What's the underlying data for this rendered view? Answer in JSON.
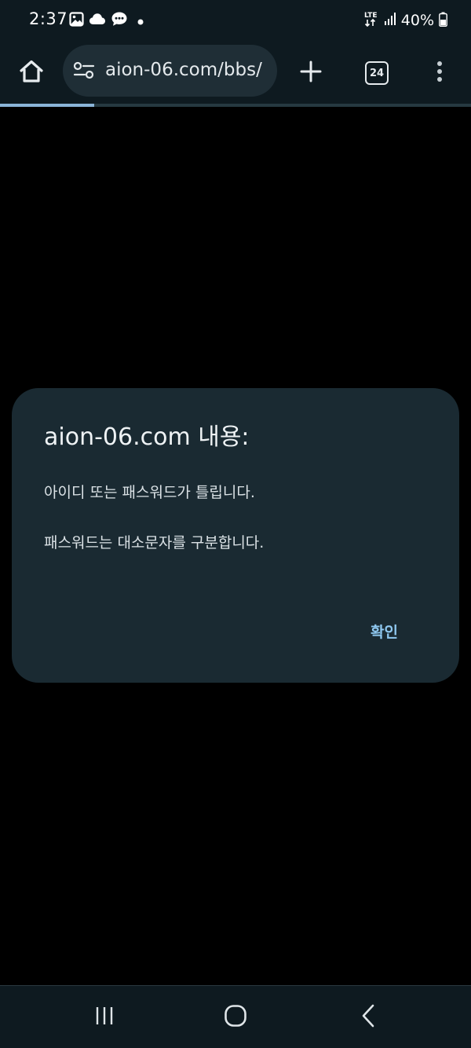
{
  "status_bar": {
    "time": "2:37",
    "battery": "40%",
    "network": "LTE",
    "icons": [
      "gallery-icon",
      "cloud-icon",
      "chat-bubble-icon",
      "notification-dot-icon",
      "lte-icon",
      "signal-icon",
      "battery-icon"
    ]
  },
  "toolbar": {
    "url": "aion-06.com/bbs/",
    "tab_count": "24",
    "icons": [
      "home-icon",
      "site-settings-icon",
      "plus-icon",
      "tabs-icon",
      "more-vertical-icon"
    ],
    "page_load_progress": 0.2
  },
  "dialog": {
    "title": "aion-06.com 내용:",
    "message_line1": "아이디 또는 패스워드가 틀립니다.",
    "message_line2": "패스워드는 대소문자를 구분합니다.",
    "ok_label": "확인"
  },
  "navigation": {
    "icons": [
      "recents-icon",
      "home-circle-icon",
      "back-chevron-icon"
    ]
  },
  "colors": {
    "background": "#000000",
    "chrome": "#0e1a20",
    "omnibox": "#1f2e36",
    "dialog": "#1a2a32",
    "accent": "#8fc8f0",
    "progress": "#8ab4d8"
  }
}
